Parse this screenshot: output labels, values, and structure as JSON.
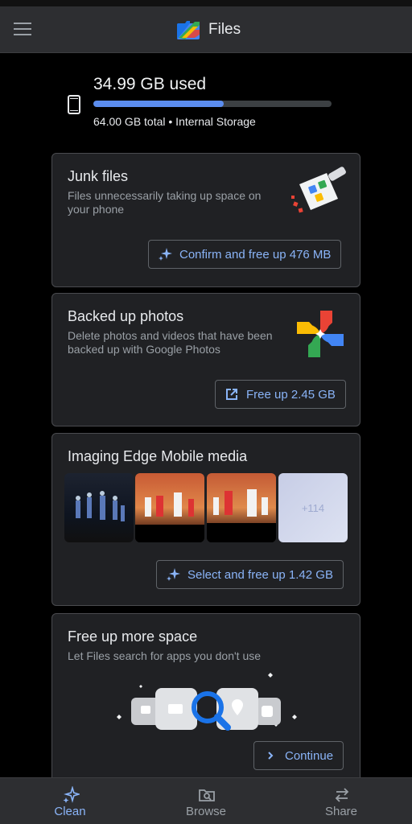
{
  "app": {
    "title": "Files"
  },
  "storage": {
    "used_label": "34.99 GB used",
    "total_label": "64.00 GB total • Internal Storage",
    "used_fraction": 0.5467
  },
  "cards": {
    "junk": {
      "title": "Junk files",
      "description_line1": "Files unnecessarily taking up space on",
      "description_line2": "your phone",
      "button_label": "Confirm and free up 476 MB"
    },
    "photos": {
      "title": "Backed up photos",
      "description_line1": "Delete photos and videos that have been",
      "description_line2": "backed up with Google Photos",
      "button_label": "Free up 2.45 GB"
    },
    "imaging": {
      "title": "Imaging Edge Mobile media",
      "more_count": "+114",
      "button_label": "Select and free up 1.42 GB"
    },
    "more_space": {
      "title": "Free up more space",
      "description": "Let Files search for apps you don't use",
      "button_label": "Continue"
    }
  },
  "nav": {
    "items": [
      {
        "label": "Clean",
        "icon": "sparkle-icon",
        "active": true
      },
      {
        "label": "Browse",
        "icon": "browse-folder-icon",
        "active": false
      },
      {
        "label": "Share",
        "icon": "swap-arrows-icon",
        "active": false
      }
    ]
  },
  "colors": {
    "accent": "#8ab4f8",
    "bar_fill": "#5b8def",
    "card_bg": "#202124",
    "app_bar": "#2d2e31"
  }
}
